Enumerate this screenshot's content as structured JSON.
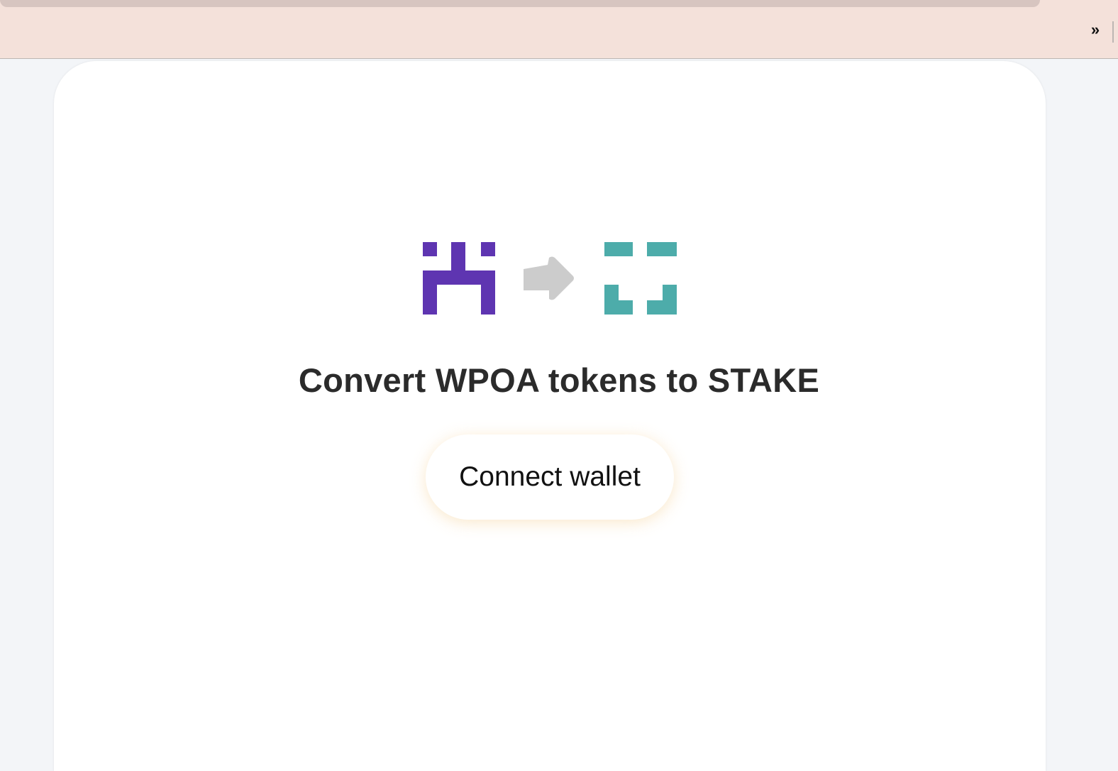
{
  "browser": {
    "overflow_icon": "chevron-double-right-icon"
  },
  "colors": {
    "browser_bar": "#f4e1da",
    "page_bg": "#f3f5f8",
    "token_from": "#5e35b1",
    "arrow": "#cccccc",
    "token_to": "#4dacaa",
    "headline": "#2b2b2b"
  },
  "icons": {
    "from_token": "wpoa-token-icon",
    "arrow": "arrow-right-icon",
    "to_token": "stake-token-icon"
  },
  "main": {
    "headline": "Convert WPOA tokens to STAKE",
    "connect_button_label": "Connect wallet"
  }
}
